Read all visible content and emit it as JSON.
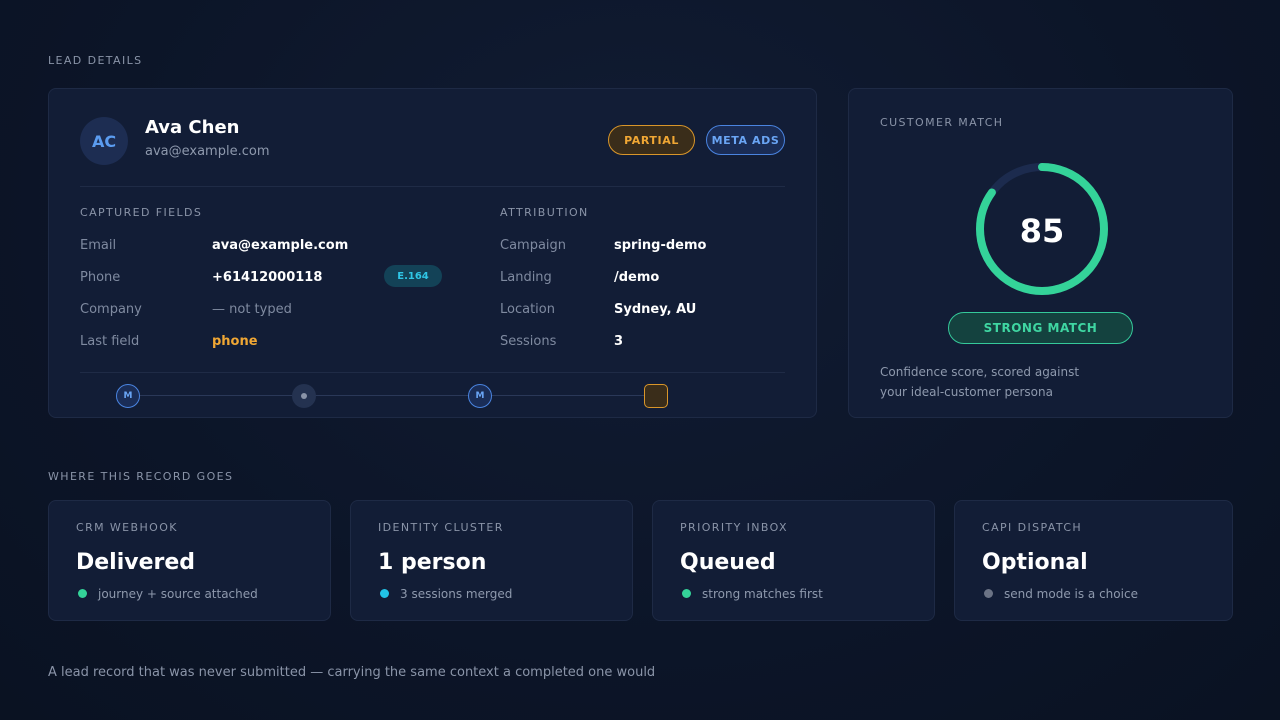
{
  "header": {
    "label": "LEAD DETAILS"
  },
  "lead": {
    "initials": "AC",
    "name": "Ava Chen",
    "email": "ava@example.com",
    "status_badge": "PARTIAL",
    "source_badge": "META ADS"
  },
  "captured": {
    "heading": "CAPTURED FIELDS",
    "rows": [
      {
        "label": "Email",
        "value": "ava@example.com"
      },
      {
        "label": "Phone",
        "value": "+61412000118",
        "tag": "E.164"
      },
      {
        "label": "Company",
        "value": "— not typed"
      },
      {
        "label": "Last field",
        "value": "phone"
      }
    ]
  },
  "attribution": {
    "heading": "ATTRIBUTION",
    "rows": [
      {
        "label": "Campaign",
        "value": "spring-demo"
      },
      {
        "label": "Landing",
        "value": "/demo"
      },
      {
        "label": "Location",
        "value": "Sydney, AU"
      },
      {
        "label": "Sessions",
        "value": "3"
      }
    ]
  },
  "timeline": {
    "nodes": [
      {
        "label": "M"
      },
      {
        "label": ""
      },
      {
        "label": "M"
      },
      {
        "label": ""
      }
    ]
  },
  "match": {
    "title": "CUSTOMER MATCH",
    "score": "85",
    "score_fraction": 0.85,
    "badge": "STRONG MATCH",
    "description": "Confidence score, scored against your ideal-customer persona",
    "color": "#34d399"
  },
  "destinations": {
    "label": "WHERE THIS RECORD GOES",
    "cards": [
      {
        "title": "CRM WEBHOOK",
        "value": "Delivered",
        "note": "journey + source attached",
        "dot_color": "#34d399"
      },
      {
        "title": "IDENTITY CLUSTER",
        "value": "1 person",
        "note": "3 sessions merged",
        "dot_color": "#22c3e6"
      },
      {
        "title": "PRIORITY INBOX",
        "value": "Queued",
        "note": "strong matches first",
        "dot_color": "#34d399"
      },
      {
        "title": "CAPI DISPATCH",
        "value": "Optional",
        "note": "send mode is a choice",
        "dot_color": "#6b7385"
      }
    ]
  },
  "footer": {
    "text": "A lead record that was never submitted — carrying the same context a completed one would"
  }
}
